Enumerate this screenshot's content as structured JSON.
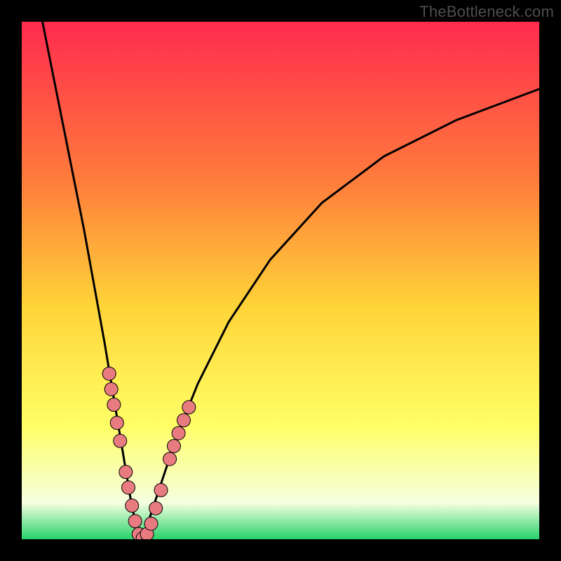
{
  "watermark": "TheBottleneck.com",
  "colors": {
    "frame": "#000000",
    "grad_top": "#ff2b4e",
    "grad_mid1": "#ff7a3c",
    "grad_mid2": "#ffd438",
    "grad_mid3": "#ffff66",
    "grad_low": "#f5ffe0",
    "grad_bottom": "#26d36a",
    "curve": "#000000",
    "marker": "#e77b80",
    "marker_stroke": "#000000"
  },
  "chart_data": {
    "type": "line",
    "title": "",
    "xlabel": "",
    "ylabel": "",
    "xlim": [
      0,
      100
    ],
    "ylim": [
      0,
      100
    ],
    "grid": false,
    "legend": false,
    "note": "Axes are unlabeled; values are estimated normalized percentages read from the figure geometry. x is horizontal position, y is vertical height of the curve (0 at bottom, 100 at top).",
    "series": [
      {
        "name": "bottleneck-curve-left",
        "x": [
          4,
          6,
          8,
          10,
          12,
          14,
          16,
          18,
          20,
          21,
          22,
          23
        ],
        "y": [
          100,
          90,
          80,
          70,
          60,
          49,
          38,
          26,
          14,
          8,
          3,
          0
        ]
      },
      {
        "name": "bottleneck-curve-right",
        "x": [
          23,
          24,
          25,
          27,
          30,
          34,
          40,
          48,
          58,
          70,
          84,
          100
        ],
        "y": [
          0,
          2,
          5,
          11,
          20,
          30,
          42,
          54,
          65,
          74,
          81,
          87
        ]
      }
    ],
    "markers": {
      "name": "highlighted-points",
      "points": [
        {
          "x": 16.9,
          "y": 32.0
        },
        {
          "x": 17.3,
          "y": 29.0
        },
        {
          "x": 17.8,
          "y": 26.0
        },
        {
          "x": 18.4,
          "y": 22.5
        },
        {
          "x": 19.0,
          "y": 19.0
        },
        {
          "x": 20.1,
          "y": 13.0
        },
        {
          "x": 20.6,
          "y": 10.0
        },
        {
          "x": 21.3,
          "y": 6.5
        },
        {
          "x": 21.9,
          "y": 3.5
        },
        {
          "x": 22.6,
          "y": 1.0
        },
        {
          "x": 23.4,
          "y": 0.2
        },
        {
          "x": 24.2,
          "y": 1.0
        },
        {
          "x": 25.0,
          "y": 3.0
        },
        {
          "x": 25.9,
          "y": 6.0
        },
        {
          "x": 26.9,
          "y": 9.5
        },
        {
          "x": 28.6,
          "y": 15.5
        },
        {
          "x": 29.4,
          "y": 18.0
        },
        {
          "x": 30.3,
          "y": 20.5
        },
        {
          "x": 31.3,
          "y": 23.0
        },
        {
          "x": 32.3,
          "y": 25.5
        }
      ]
    },
    "minimum": {
      "x": 23,
      "y": 0
    }
  }
}
